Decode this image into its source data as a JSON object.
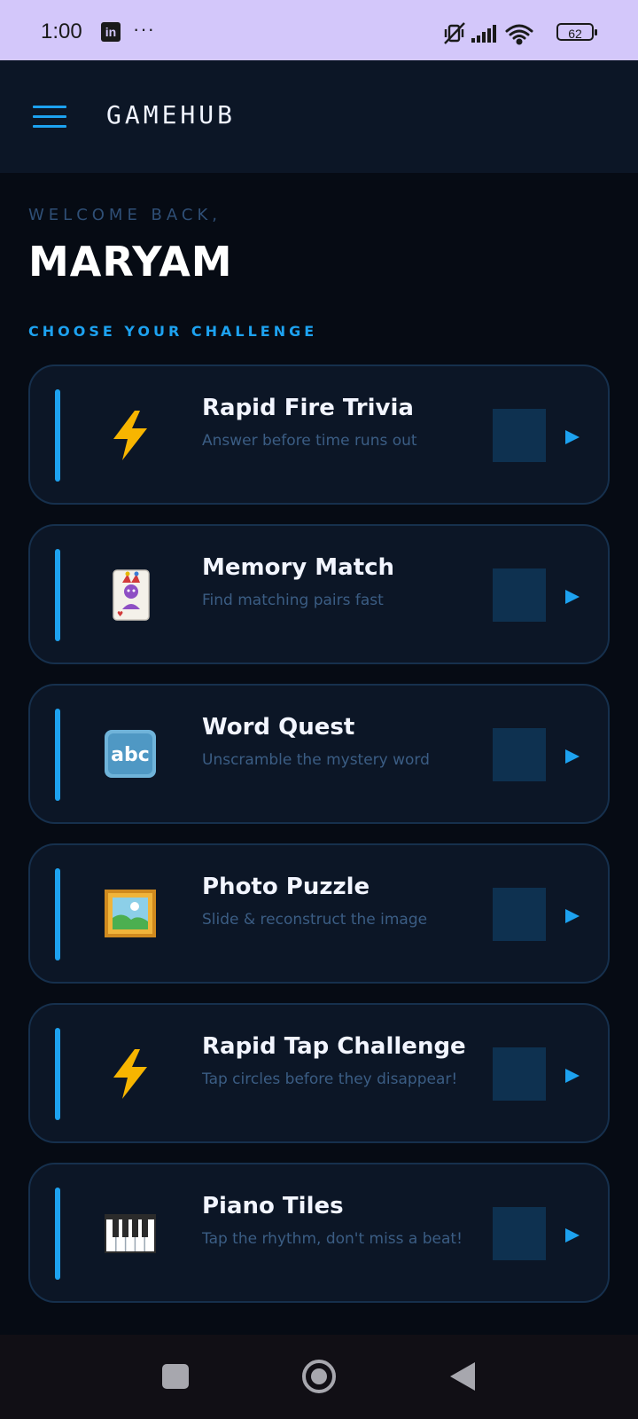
{
  "status_bar": {
    "time": "1:00",
    "linkedin_label": "in",
    "overflow": "···",
    "battery": "62",
    "icons": [
      "linkedin-icon",
      "vibrate-mute-icon",
      "signal-icon",
      "wifi-icon",
      "battery-icon"
    ]
  },
  "header": {
    "title": "GAMEHUB",
    "menu_icon": "hamburger-menu-icon"
  },
  "greeting": {
    "welcome": "WELCOME BACK,",
    "name": "MARYAM"
  },
  "section_label": "CHOOSE YOUR CHALLENGE",
  "games": [
    {
      "title": "Rapid Fire Trivia",
      "subtitle": "Answer before time runs out",
      "icon": "lightning-icon"
    },
    {
      "title": "Memory Match",
      "subtitle": "Find matching pairs fast",
      "icon": "joker-card-icon"
    },
    {
      "title": "Word Quest",
      "subtitle": "Unscramble the mystery word",
      "icon": "abc-icon"
    },
    {
      "title": "Photo Puzzle",
      "subtitle": "Slide & reconstruct the image",
      "icon": "framed-picture-icon"
    },
    {
      "title": "Rapid Tap Challenge",
      "subtitle": "Tap circles before they disappear!",
      "icon": "lightning-icon"
    },
    {
      "title": "Piano Tiles",
      "subtitle": "Tap the rhythm, don't miss a beat!",
      "icon": "piano-keys-icon"
    }
  ],
  "nav_bar": {
    "buttons": [
      "recents-square-icon",
      "home-circle-icon",
      "back-triangle-icon"
    ]
  },
  "colors": {
    "background": "#060b14",
    "header": "#0c1626",
    "accent": "#1da2f0",
    "card_border": "#16304d",
    "status_bar": "#d3c7fa"
  }
}
